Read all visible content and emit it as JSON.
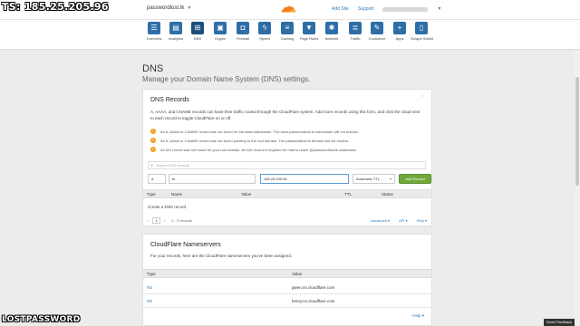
{
  "overlay": {
    "ip_text": "TS: 185.25.205.96",
    "brand": "LOSTPASSWORD"
  },
  "topbar": {
    "domain": "passwordlost.tk",
    "links": [
      "Add Site",
      "Support"
    ]
  },
  "nav": [
    {
      "label": "Overview",
      "icon": "list-icon"
    },
    {
      "label": "Analytics",
      "icon": "chart-icon"
    },
    {
      "label": "DNS",
      "icon": "network-icon"
    },
    {
      "label": "Crypto",
      "icon": "lock-icon"
    },
    {
      "label": "Firewall",
      "icon": "shield-icon"
    },
    {
      "label": "Speed",
      "icon": "bolt-icon"
    },
    {
      "label": "Caching",
      "icon": "server-icon"
    },
    {
      "label": "Page Rules",
      "icon": "filter-icon"
    },
    {
      "label": "Network",
      "icon": "nodes-icon"
    },
    {
      "label": "Traffic",
      "icon": "traffic-icon"
    },
    {
      "label": "Customize",
      "icon": "wrench-icon"
    },
    {
      "label": "Apps",
      "icon": "plus-icon"
    },
    {
      "label": "Scrape Shield",
      "icon": "document-icon"
    }
  ],
  "page": {
    "title": "DNS",
    "subtitle": "Manage your Domain Name System (DNS) settings."
  },
  "dns_card": {
    "title": "DNS Records",
    "description": "A, AAAA, and CNAME records can have their traffic routed through the CloudFlare system. Add more records using this form, and click the cloud next to each record to toggle CloudFlare on or off.",
    "warnings": [
      "An A, AAAA or CNAME record was not found for the www subdomain. The www.passwordlost.tk subdomain will not resolve.",
      "An A, AAAA or CNAME record was not found pointing to the root domain. The passwordlost.tk domain will not resolve.",
      "An MX record was not found for your root domain. An MX record is required for mail to reach @passwordlost.tk addresses."
    ],
    "search_placeholder": "Search DNS records",
    "form": {
      "type": "A",
      "name": "ts",
      "value": "185.25.205.96",
      "ttl": "Automatic TTL",
      "add_button": "Add Record"
    },
    "columns": [
      "Type",
      "Name",
      "Value",
      "TTL",
      "Status"
    ],
    "create_text": "Create a DNS record",
    "pager": {
      "prev": "‹",
      "page": "1",
      "next": "›",
      "range": "0 - 0 records",
      "links": [
        "Advanced ▾",
        "API ▾",
        "Help ▾"
      ]
    }
  },
  "ns_card": {
    "title": "CloudFlare Nameservers",
    "description": "For your records, here are the CloudFlare nameservers you've been assigned.",
    "columns": [
      "Type",
      "Value"
    ],
    "rows": [
      {
        "type": "NS",
        "value": "gwen.ns.cloudflare.com"
      },
      {
        "type": "NS",
        "value": "henry.ns.cloudflare.com"
      }
    ],
    "help": "Help ▾"
  },
  "feedback": "Send Feedback",
  "colors": {
    "nav_icon": "#2e6ea6",
    "add_button": "#70a83b",
    "warning": "#f0a021",
    "link": "#2f7bbf"
  }
}
